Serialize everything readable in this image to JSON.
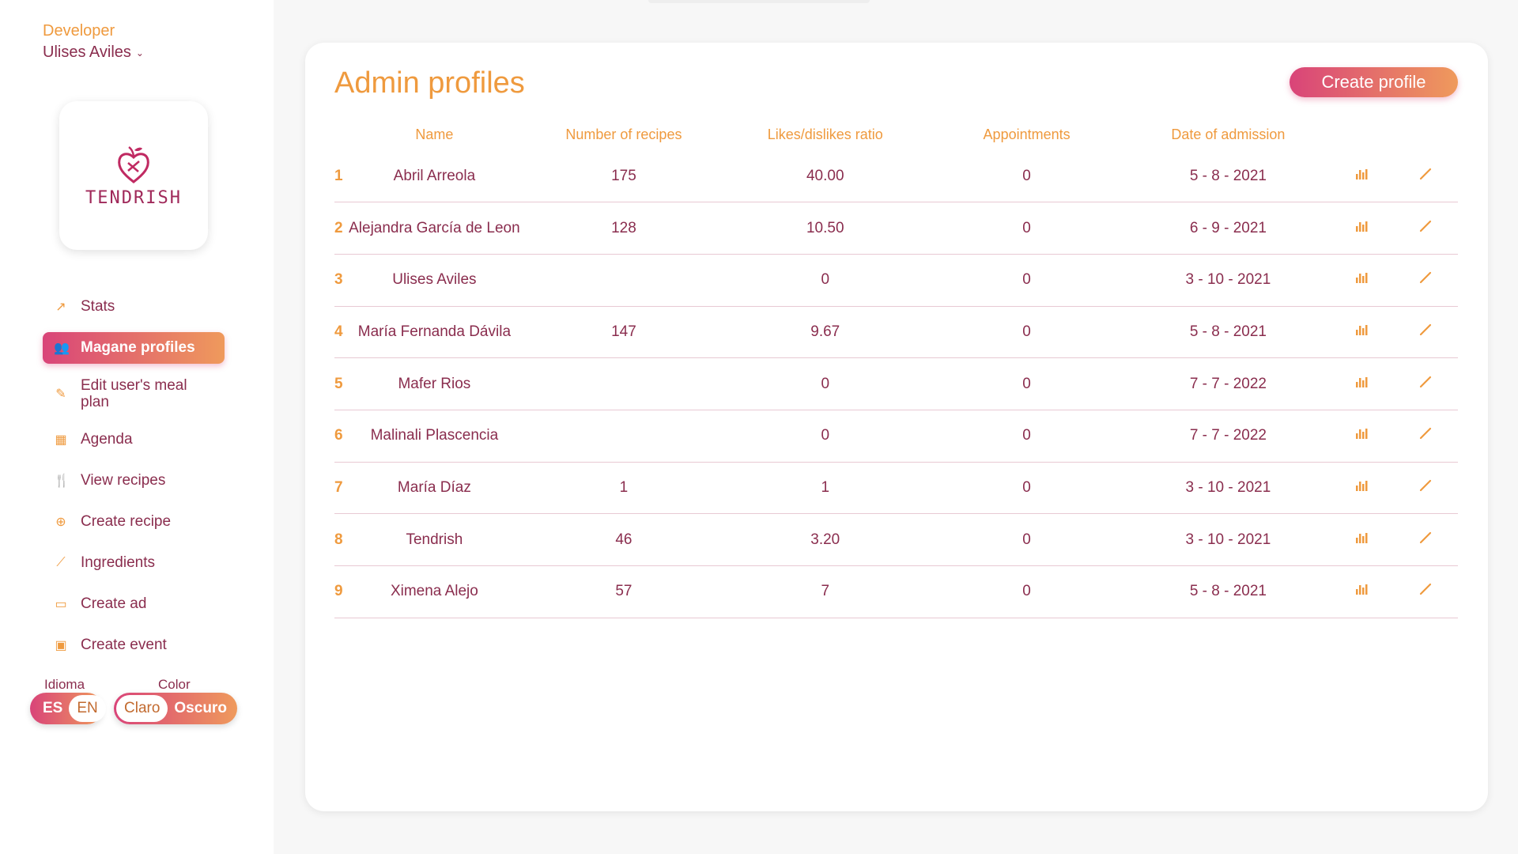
{
  "sidebar": {
    "role": "Developer",
    "user": "Ulises Aviles",
    "logo_text": "TENDRISH",
    "items": [
      {
        "label": "Stats",
        "icon": "trending-up-icon"
      },
      {
        "label": "Magane profiles",
        "icon": "people-icon",
        "active": true
      },
      {
        "label": "Edit user's meal plan",
        "icon": "pencil-icon"
      },
      {
        "label": "Agenda",
        "icon": "calendar-icon"
      },
      {
        "label": "View recipes",
        "icon": "utensils-icon"
      },
      {
        "label": "Create recipe",
        "icon": "plus-circle-icon"
      },
      {
        "label": "Ingredients",
        "icon": "carrot-icon"
      },
      {
        "label": "Create ad",
        "icon": "ad-icon"
      },
      {
        "label": "Create event",
        "icon": "event-icon"
      }
    ],
    "language": {
      "label": "Idioma",
      "options": [
        "ES",
        "EN"
      ],
      "selected": "EN"
    },
    "color": {
      "label": "Color",
      "options": [
        "Claro",
        "Oscuro"
      ],
      "selected": "Claro"
    }
  },
  "main": {
    "title": "Admin profiles",
    "create_button": "Create profile",
    "columns": [
      "Name",
      "Number of recipes",
      "Likes/dislikes ratio",
      "Appointments",
      "Date of admission"
    ],
    "rows": [
      {
        "idx": "1",
        "name": "Abril Arreola",
        "recipes": "175",
        "ratio": "40.00",
        "appointments": "0",
        "date": "5 - 8 - 2021"
      },
      {
        "idx": "2",
        "name": "Alejandra García de Leon",
        "recipes": "128",
        "ratio": "10.50",
        "appointments": "0",
        "date": "6 - 9 - 2021"
      },
      {
        "idx": "3",
        "name": "Ulises Aviles",
        "recipes": "",
        "ratio": "0",
        "appointments": "0",
        "date": "3 - 10 - 2021"
      },
      {
        "idx": "4",
        "name": "María Fernanda Dávila",
        "recipes": "147",
        "ratio": "9.67",
        "appointments": "0",
        "date": "5 - 8 - 2021"
      },
      {
        "idx": "5",
        "name": "Mafer Rios",
        "recipes": "",
        "ratio": "0",
        "appointments": "0",
        "date": "7 - 7 - 2022"
      },
      {
        "idx": "6",
        "name": "Malinali Plascencia",
        "recipes": "",
        "ratio": "0",
        "appointments": "0",
        "date": "7 - 7 - 2022"
      },
      {
        "idx": "7",
        "name": "María Díaz",
        "recipes": "1",
        "ratio": "1",
        "appointments": "0",
        "date": "3 - 10 - 2021"
      },
      {
        "idx": "8",
        "name": "Tendrish",
        "recipes": "46",
        "ratio": "3.20",
        "appointments": "0",
        "date": "3 - 10 - 2021"
      },
      {
        "idx": "9",
        "name": "Ximena Alejo",
        "recipes": "57",
        "ratio": "7",
        "appointments": "0",
        "date": "5 - 8 - 2021"
      }
    ]
  },
  "colors": {
    "accent_orange": "#ef9a3e",
    "accent_pink": "#d94479",
    "text": "#8a2d4e"
  }
}
